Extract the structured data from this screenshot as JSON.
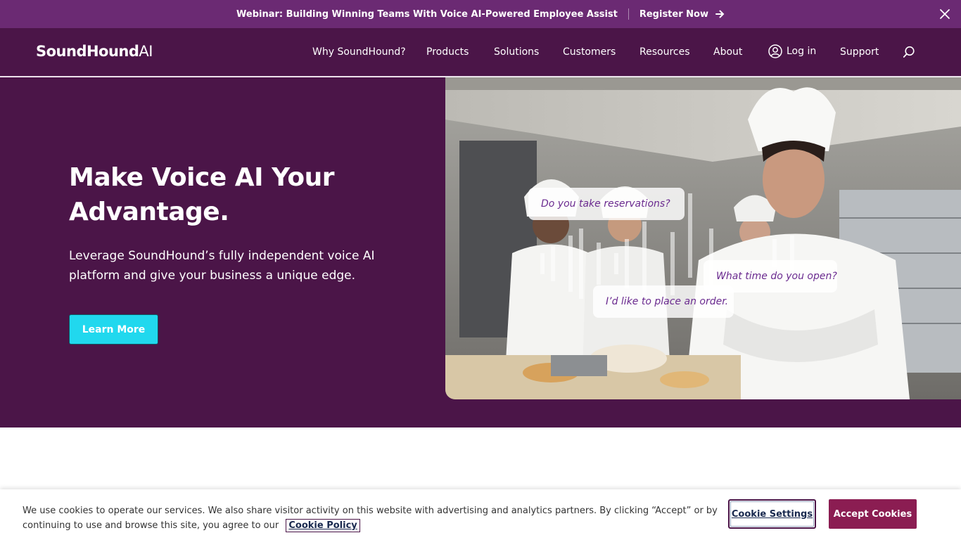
{
  "announcement": {
    "message": "Webinar: Building Winning Teams With Voice AI-Powered Employee Assist",
    "cta": "Register Now",
    "cta_icon": "arrow-right-icon",
    "close_icon": "close-icon"
  },
  "nav": {
    "logo": {
      "brand": "SoundHound",
      "suffix": "AI"
    },
    "links": [
      "Why SoundHound?",
      "Products",
      "Solutions",
      "Customers",
      "Resources",
      "About"
    ],
    "login": {
      "label": "Log in",
      "icon": "user-circle-icon"
    },
    "support": "Support",
    "search_icon": "search-icon"
  },
  "hero": {
    "title": "Make Voice AI Your Advantage.",
    "subtitle": "Leverage SoundHound’s fully independent voice AI platform and give your business a unique edge.",
    "button": "Learn More",
    "image": {
      "bubbles": [
        "Do you take reservations?",
        "What time do you open?",
        "I’d like to place an order."
      ]
    }
  },
  "cookie_banner": {
    "text": "We use cookies to operate our services. We also share visitor activity on this website with advertising and analytics partners. By clicking “Accept” or by continuing to use and browse this site, you agree to our",
    "policy_link": "Cookie Policy",
    "settings_button": "Cookie Settings",
    "accept_button": "Accept Cookies"
  },
  "colors": {
    "announcement_bg": "#6b2a73",
    "brand_purple": "#4b1548",
    "cta_cyan": "#21d8ee",
    "accept_bg": "#8b1d52"
  }
}
